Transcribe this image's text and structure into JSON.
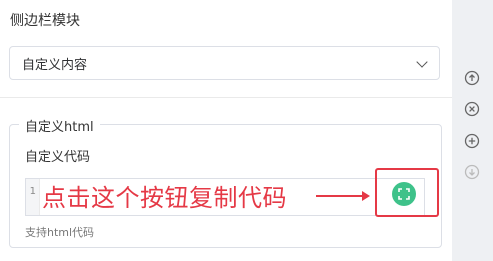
{
  "panel": {
    "title": "侧边栏模块",
    "select": {
      "value": "自定义内容"
    },
    "fieldset": {
      "legend": "自定义html",
      "code_label": "自定义代码",
      "editor": {
        "line_number": "1"
      },
      "hint": "支持html代码"
    }
  },
  "annotation": {
    "text": "点击这个按钮复制代码",
    "color": "#e53946"
  },
  "fullscreen_button": {
    "icon": "expand-icon",
    "color": "#3ec28a"
  },
  "toolbar": {
    "icons": [
      "arrow-up-circle-icon",
      "close-circle-icon",
      "plus-circle-icon",
      "arrow-down-circle-icon"
    ]
  }
}
